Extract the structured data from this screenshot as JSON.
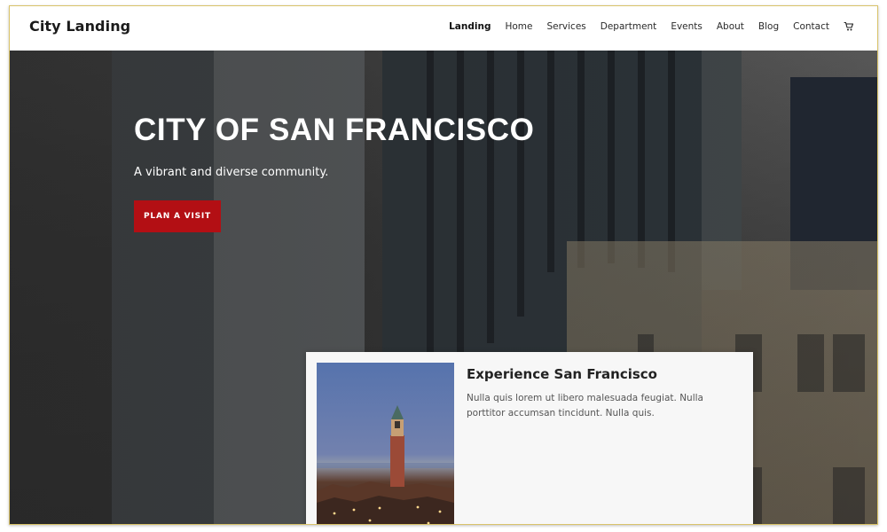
{
  "site": {
    "logo": "City Landing"
  },
  "nav": {
    "items": [
      {
        "label": "Landing",
        "active": true
      },
      {
        "label": "Home",
        "active": false
      },
      {
        "label": "Services",
        "active": false
      },
      {
        "label": "Department",
        "active": false
      },
      {
        "label": "Events",
        "active": false
      },
      {
        "label": "About",
        "active": false
      },
      {
        "label": "Blog",
        "active": false
      },
      {
        "label": "Contact",
        "active": false
      }
    ],
    "cart_icon": "cart-icon"
  },
  "hero": {
    "title": "CITY OF SAN FRANCISCO",
    "subtitle": "A vibrant and diverse community.",
    "button_label": "PLAN A VISIT",
    "accent_color": "#b30f14"
  },
  "card": {
    "title": "Experience San Francisco",
    "text": "Nulla quis lorem ut libero malesuada feugiat. Nulla porttitor accumsan tincidunt. Nulla quis."
  }
}
